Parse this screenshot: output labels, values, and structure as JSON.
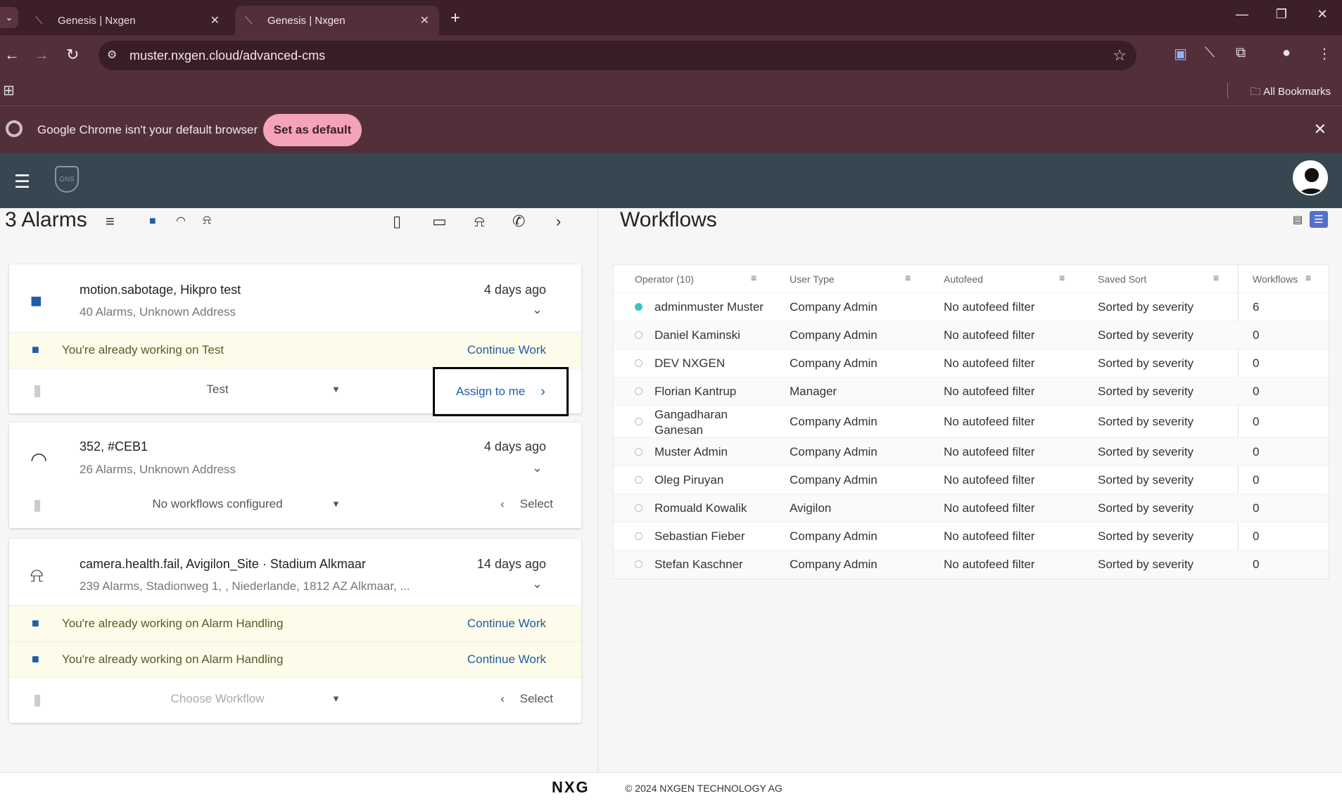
{
  "browser": {
    "tabs": [
      {
        "title": "Genesis | Nxgen",
        "active": false
      },
      {
        "title": "Genesis | Nxgen",
        "active": true
      }
    ],
    "url": "muster.nxgen.cloud/advanced-cms",
    "bookmarks_label": "All Bookmarks",
    "infobar": {
      "message": "Google Chrome isn't your default browser",
      "button": "Set as default"
    }
  },
  "app": {
    "logo_text": "GNS"
  },
  "alarms": {
    "title": "3 Alarms",
    "cards": [
      {
        "icon": "camera-icon",
        "title": "motion.sabotage, Hikpro test",
        "subtitle": "40 Alarms, Unknown Address",
        "time": "4 days ago",
        "working": [
          {
            "text": "You're already working on Test",
            "link": "Continue Work"
          }
        ],
        "workflow": "Test",
        "action": "Assign to me"
      },
      {
        "icon": "wifi-icon",
        "title": "352, #CEB1",
        "subtitle": "26 Alarms, Unknown Address",
        "time": "4 days ago",
        "working": [],
        "workflow": "No workflows configured",
        "action": "Select"
      },
      {
        "icon": "bell-icon",
        "title": "camera.health.fail, Avigilon_Site · Stadium Alkmaar",
        "subtitle": "239 Alarms, Stadionweg 1, , Niederlande, 1812 AZ Alkmaar, ...",
        "time": "14 days ago",
        "working": [
          {
            "text": "You're already working on Alarm Handling",
            "link": "Continue Work"
          },
          {
            "text": "You're already working on Alarm Handling",
            "link": "Continue Work"
          }
        ],
        "workflow": "Choose Workflow",
        "action": "Select"
      }
    ]
  },
  "workflows": {
    "title": "Workflows",
    "columns": [
      "Operator (10)",
      "User Type",
      "Autofeed",
      "Saved Sort",
      "Workflows"
    ],
    "rows": [
      {
        "online": true,
        "operator": "adminmuster Muster",
        "user_type": "Company Admin",
        "autofeed": "No autofeed filter",
        "sort": "Sorted by severity",
        "count": "6"
      },
      {
        "online": false,
        "operator": "Daniel Kaminski",
        "user_type": "Company Admin",
        "autofeed": "No autofeed filter",
        "sort": "Sorted by severity",
        "count": "0"
      },
      {
        "online": false,
        "operator": "DEV NXGEN",
        "user_type": "Company Admin",
        "autofeed": "No autofeed filter",
        "sort": "Sorted by severity",
        "count": "0"
      },
      {
        "online": false,
        "operator": "Florian Kantrup",
        "user_type": "Manager",
        "autofeed": "No autofeed filter",
        "sort": "Sorted by severity",
        "count": "0"
      },
      {
        "online": false,
        "operator": "Gangadharan Ganesan",
        "user_type": "Company Admin",
        "autofeed": "No autofeed filter",
        "sort": "Sorted by severity",
        "count": "0"
      },
      {
        "online": false,
        "operator": "Muster Admin",
        "user_type": "Company Admin",
        "autofeed": "No autofeed filter",
        "sort": "Sorted by severity",
        "count": "0"
      },
      {
        "online": false,
        "operator": "Oleg Piruyan",
        "user_type": "Company Admin",
        "autofeed": "No autofeed filter",
        "sort": "Sorted by severity",
        "count": "0"
      },
      {
        "online": false,
        "operator": "Romuald Kowalik",
        "user_type": "Avigilon",
        "autofeed": "No autofeed filter",
        "sort": "Sorted by severity",
        "count": "0"
      },
      {
        "online": false,
        "operator": "Sebastian Fieber",
        "user_type": "Company Admin",
        "autofeed": "No autofeed filter",
        "sort": "Sorted by severity",
        "count": "0"
      },
      {
        "online": false,
        "operator": "Stefan Kaschner",
        "user_type": "Company Admin",
        "autofeed": "No autofeed filter",
        "sort": "Sorted by severity",
        "count": "0"
      }
    ]
  },
  "footer": {
    "logo": "NXG",
    "copyright": "© 2024 NXGEN TECHNOLOGY AG"
  },
  "colors": {
    "accent": "#1f5ea8",
    "online": "#3cc4c4",
    "appbar": "#364751"
  }
}
